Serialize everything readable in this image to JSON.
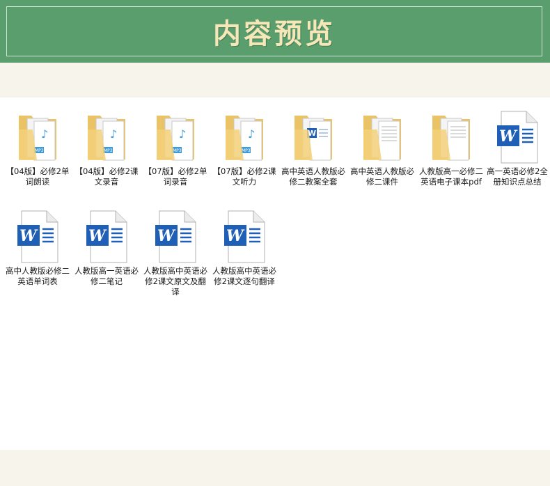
{
  "header": {
    "title": "内容预览"
  },
  "files": [
    {
      "name": "【04版】必修2单词朗读",
      "icon": "folder-mp3-icon"
    },
    {
      "name": "【04版】必修2课文录音",
      "icon": "folder-mp3-icon"
    },
    {
      "name": "【07版】必修2单词录音",
      "icon": "folder-mp3-icon"
    },
    {
      "name": "【07版】必修2课文听力",
      "icon": "folder-mp3-icon"
    },
    {
      "name": "高中英语人教版必修二教案全套",
      "icon": "folder-word-icon"
    },
    {
      "name": "高中英语人教版必修二课件",
      "icon": "folder-docs-icon"
    },
    {
      "name": "人教版高一必修二英语电子课本pdf",
      "icon": "folder-docs-icon"
    },
    {
      "name": "高一英语必修2全册知识点总结",
      "icon": "word-document-icon"
    },
    {
      "name": "高中人教版必修二英语单词表",
      "icon": "word-document-icon"
    },
    {
      "name": "人教版高一英语必修二笔记",
      "icon": "word-document-icon"
    },
    {
      "name": "人教版高中英语必修2课文原文及翻译",
      "icon": "word-document-icon"
    },
    {
      "name": "人教版高中英语必修2课文逐句翻译",
      "icon": "word-document-icon"
    }
  ],
  "colors": {
    "banner": "#5a9e6e",
    "title": "#f6e7b8",
    "strip": "#f7f4ec",
    "word_blue": "#1f5fb5",
    "folder": "#f3d179"
  }
}
